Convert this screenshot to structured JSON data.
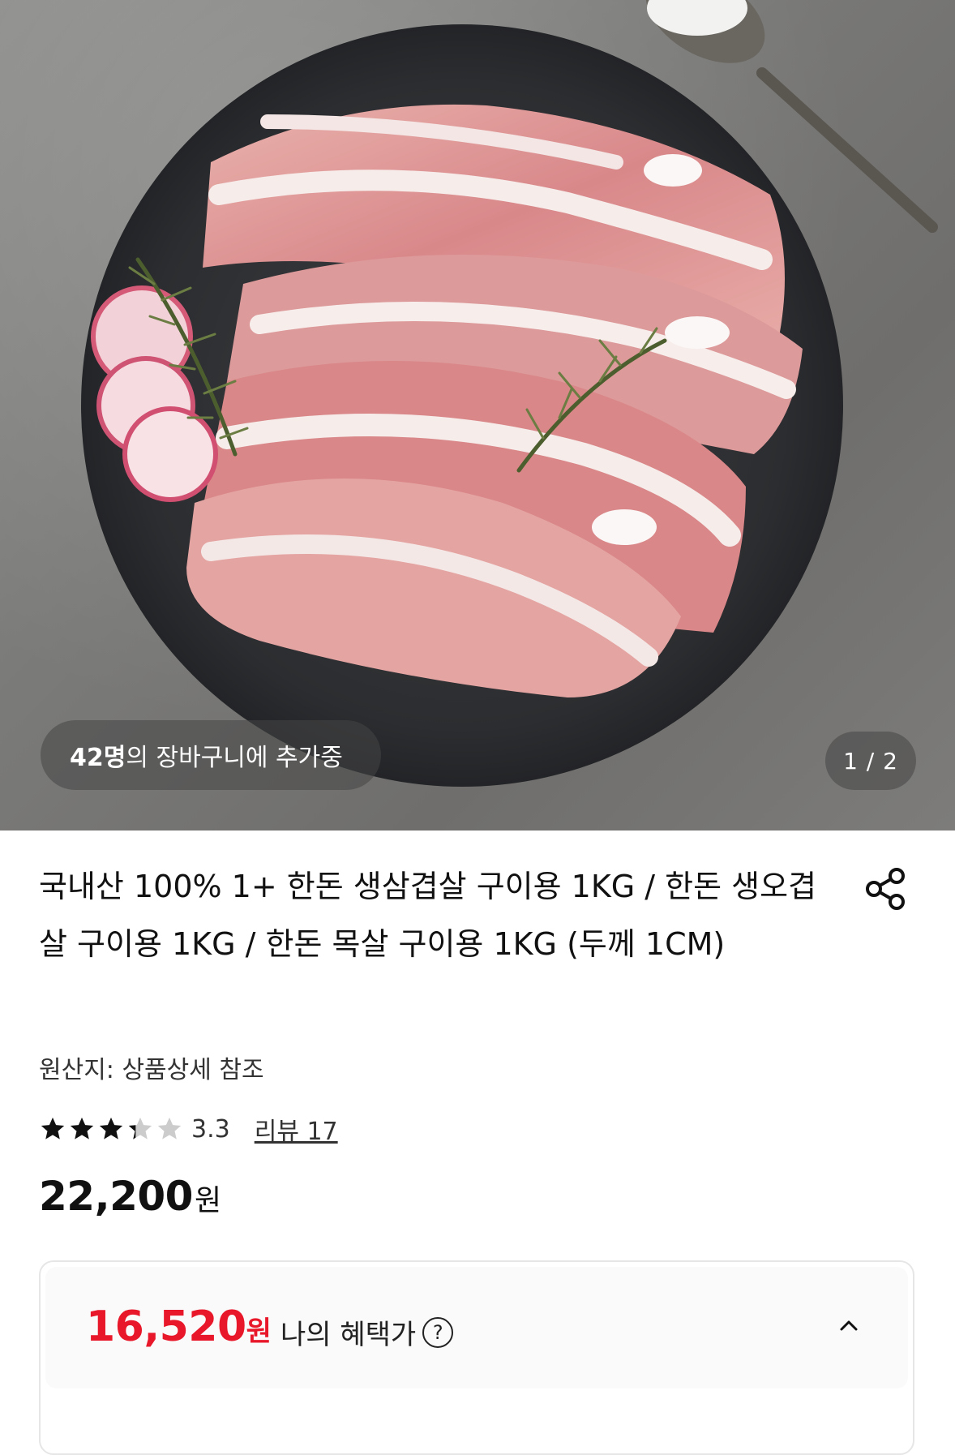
{
  "hero": {
    "image_subject": "raw pork belly slices on slate plate with rosemary, radish and salt spoon",
    "cart_count": "42명",
    "cart_text": "의 장바구니에 추가중",
    "pager": "1 / 2"
  },
  "product": {
    "title": "국내산 100% 1+ 한돈 생삼겹살 구이용 1KG / 한돈 생오겹살 구이용 1KG / 한돈 목살 구이용 1KG (두께 1CM)",
    "origin": "원산지: 상품상세 참조",
    "rating": 3.3,
    "rating_text": "3.3",
    "review_link": "리뷰 17",
    "price": "22,200",
    "price_unit": "원"
  },
  "benefit": {
    "price": "16,520",
    "price_unit": "원",
    "label": "나의 혜택가",
    "help_symbol": "?"
  },
  "colors": {
    "accent_red": "#e8182a",
    "star_filled": "#111111",
    "star_empty": "#cccccc"
  },
  "icons": [
    "share-icon",
    "help-icon",
    "chevron-up-icon",
    "star-icon"
  ]
}
